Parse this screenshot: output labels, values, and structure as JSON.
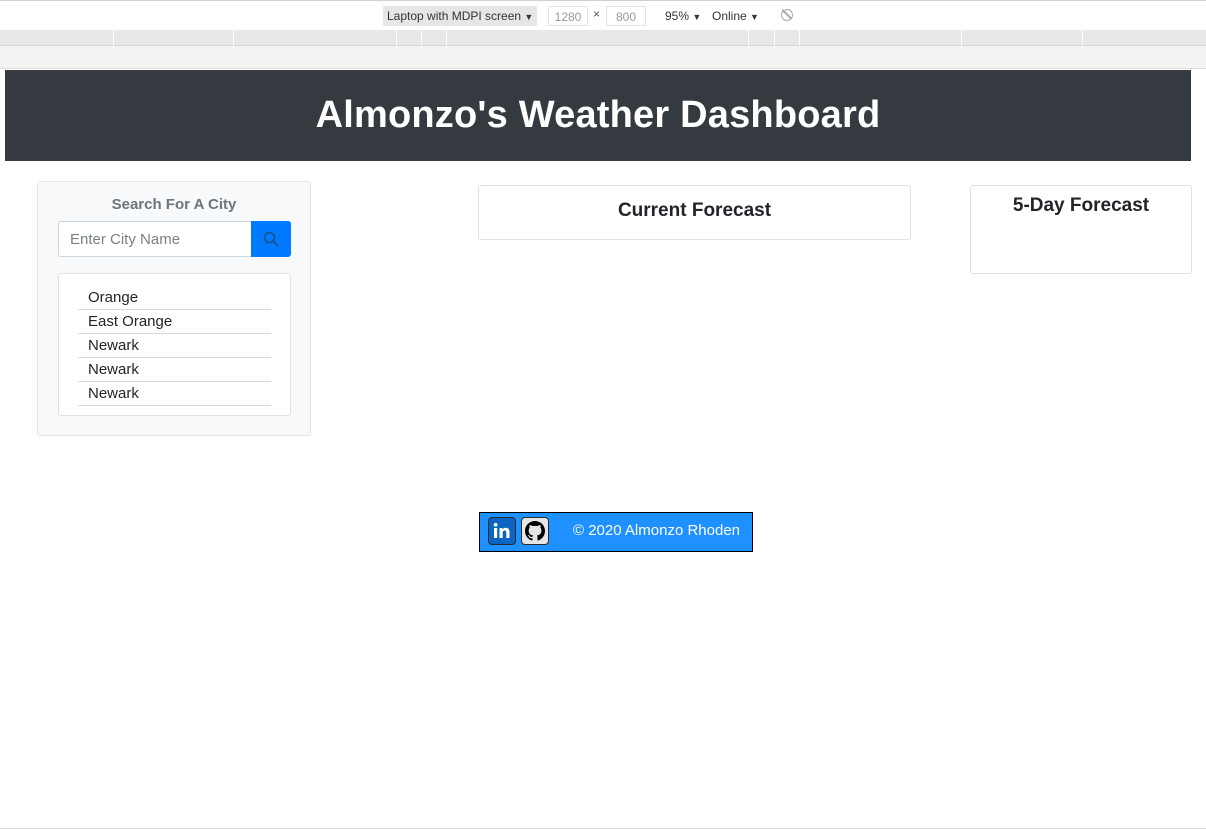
{
  "devtools": {
    "device": "Laptop with MDPI screen",
    "width": "1280",
    "height": "800",
    "dimension_separator": "×",
    "zoom": "95%",
    "throttling": "Online",
    "dropdown_glyph": "▼"
  },
  "header": {
    "title": "Almonzo's Weather Dashboard"
  },
  "search": {
    "title": "Search For A City",
    "placeholder": "Enter City Name",
    "button_icon": "search-icon"
  },
  "cities": [
    "Orange",
    "East Orange",
    "Newark",
    "Newark",
    "Newark"
  ],
  "current_forecast": {
    "title": "Current Forecast"
  },
  "five_day_forecast": {
    "title": "5-Day Forecast"
  },
  "footer": {
    "copyright": "© 2020 Almonzo Rhoden",
    "linkedin_icon": "linkedin-icon",
    "github_icon": "github-icon"
  },
  "colors": {
    "header_bg": "#343a40",
    "accent": "#007bff",
    "footer_bg": "#1e90ff",
    "panel_bg": "#f8f9fa"
  }
}
